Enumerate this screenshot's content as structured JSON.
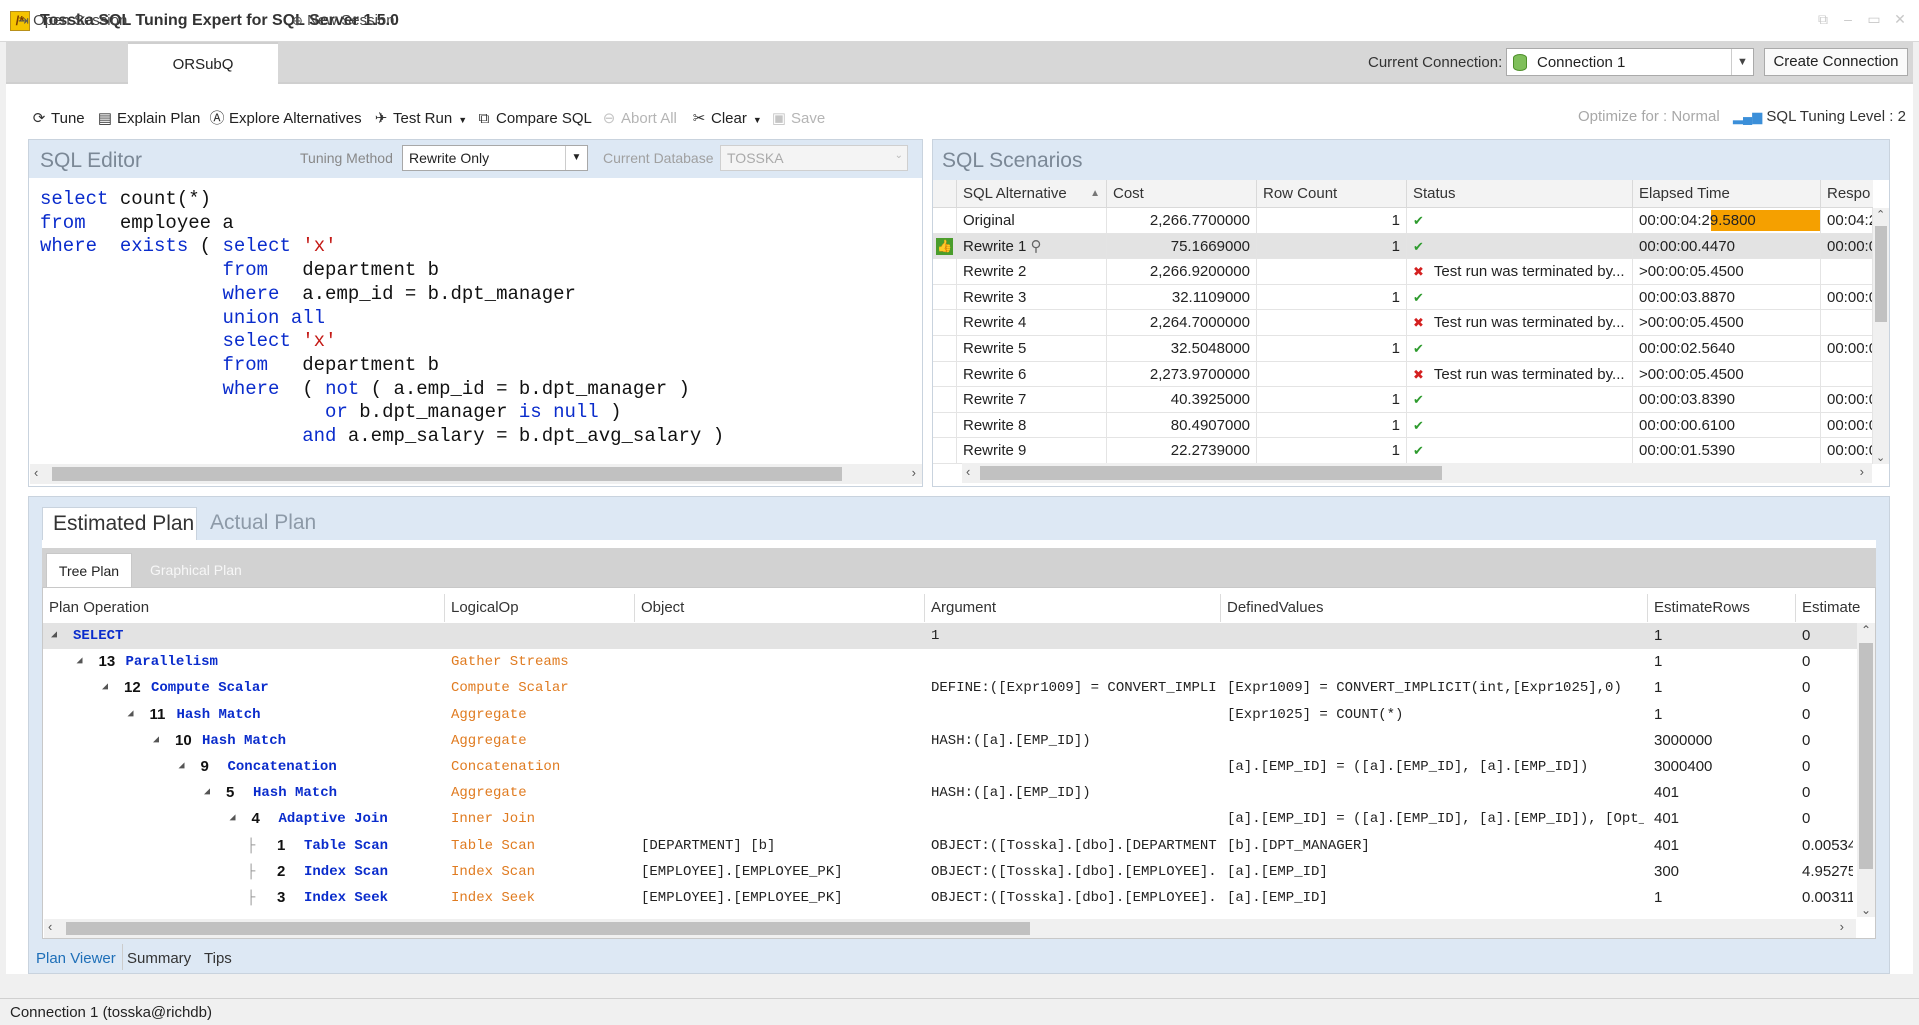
{
  "app": {
    "title": "Tosska SQL Tuning Expert for SQL Server 1.5.0",
    "icon_glyph": "/*"
  },
  "session_tabs": [
    {
      "label": "Open Session",
      "icon": "open-session-icon"
    },
    {
      "label": "ORSubQ",
      "active": true
    },
    {
      "label": "New Session",
      "icon": "new-session-icon"
    }
  ],
  "connection": {
    "label": "Current Connection:",
    "value": "Connection 1",
    "create_button": "Create Connection"
  },
  "toolbar": {
    "tune": "Tune",
    "explain_plan": "Explain Plan",
    "explore_alternatives": "Explore Alternatives",
    "test_run": "Test Run",
    "compare_sql": "Compare SQL",
    "abort_all": "Abort All",
    "clear": "Clear",
    "save": "Save",
    "optimize_for": "Optimize for : Normal",
    "tuning_level": "SQL Tuning Level : 2"
  },
  "editor": {
    "title": "SQL Editor",
    "tuning_method_label": "Tuning Method",
    "tuning_method_value": "Rewrite Only",
    "current_db_label": "Current Database",
    "current_db_value": "TOSSKA"
  },
  "scenarios": {
    "title": "SQL Scenarios",
    "columns": [
      "SQL Alternative",
      "Cost",
      "Row Count",
      "Status",
      "Elapsed Time",
      "Respo"
    ],
    "rows": [
      {
        "name": "Original",
        "cost": "2,266.7700000",
        "rows": "1",
        "status": "ok",
        "status_text": "",
        "elapsed": "00:00:04:29.5800",
        "resp": "00:04:2",
        "bar": 1.0
      },
      {
        "name": "Rewrite 1",
        "cost": "75.1669000",
        "rows": "1",
        "status": "ok",
        "status_text": "",
        "elapsed": "00:00:00.4470",
        "resp": "00:00:0",
        "best": true,
        "pin": true,
        "bar": 0
      },
      {
        "name": "Rewrite 2",
        "cost": "2,266.9200000",
        "rows": "",
        "status": "fail",
        "status_text": "Test run was terminated by...",
        "elapsed": ">00:00:05.4500",
        "resp": "",
        "bar": 0
      },
      {
        "name": "Rewrite 3",
        "cost": "32.1109000",
        "rows": "1",
        "status": "ok",
        "status_text": "",
        "elapsed": "00:00:03.8870",
        "resp": "00:00:0",
        "bar": 0
      },
      {
        "name": "Rewrite 4",
        "cost": "2,264.7000000",
        "rows": "",
        "status": "fail",
        "status_text": "Test run was terminated by...",
        "elapsed": ">00:00:05.4500",
        "resp": "",
        "bar": 0
      },
      {
        "name": "Rewrite 5",
        "cost": "32.5048000",
        "rows": "1",
        "status": "ok",
        "status_text": "",
        "elapsed": "00:00:02.5640",
        "resp": "00:00:0",
        "bar": 0
      },
      {
        "name": "Rewrite 6",
        "cost": "2,273.9700000",
        "rows": "",
        "status": "fail",
        "status_text": "Test run was terminated by...",
        "elapsed": ">00:00:05.4500",
        "resp": "",
        "bar": 0
      },
      {
        "name": "Rewrite 7",
        "cost": "40.3925000",
        "rows": "1",
        "status": "ok",
        "status_text": "",
        "elapsed": "00:00:03.8390",
        "resp": "00:00:0",
        "bar": 0
      },
      {
        "name": "Rewrite 8",
        "cost": "80.4907000",
        "rows": "1",
        "status": "ok",
        "status_text": "",
        "elapsed": "00:00:00.6100",
        "resp": "00:00:0",
        "bar": 0
      },
      {
        "name": "Rewrite 9",
        "cost": "22.2739000",
        "rows": "1",
        "status": "ok",
        "status_text": "",
        "elapsed": "00:00:01.5390",
        "resp": "00:00:0",
        "bar": 0
      }
    ]
  },
  "plan": {
    "tabs": [
      "Estimated Plan",
      "Actual Plan"
    ],
    "sub_tabs": [
      "Tree Plan",
      "Graphical Plan"
    ],
    "columns": [
      "Plan Operation",
      "LogicalOp",
      "Object",
      "Argument",
      "DefinedValues",
      "EstimateRows",
      "Estimate"
    ],
    "rows": [
      {
        "depth": 0,
        "id": "",
        "op": "SELECT",
        "logical": "",
        "object": "",
        "argument": "1",
        "defined": "",
        "erows": "1",
        "est": "0"
      },
      {
        "depth": 1,
        "id": "13",
        "op": "Parallelism",
        "logical": "Gather Streams",
        "object": "",
        "argument": "",
        "defined": "",
        "erows": "1",
        "est": "0"
      },
      {
        "depth": 2,
        "id": "12",
        "op": "Compute Scalar",
        "logical": "Compute Scalar",
        "object": "",
        "argument": "DEFINE:([Expr1009] = CONVERT_IMPLIC",
        "defined": "[Expr1009] = CONVERT_IMPLICIT(int,[Expr1025],0)",
        "erows": "1",
        "est": "0"
      },
      {
        "depth": 3,
        "id": "11",
        "op": "Hash Match",
        "logical": "Aggregate",
        "object": "",
        "argument": "",
        "defined": "[Expr1025] = COUNT(*)",
        "erows": "1",
        "est": "0"
      },
      {
        "depth": 4,
        "id": "10",
        "op": "Hash Match",
        "logical": "Aggregate",
        "object": "",
        "argument": "HASH:([a].[EMP_ID])",
        "defined": "",
        "erows": "3000000",
        "est": "0"
      },
      {
        "depth": 5,
        "id": "9",
        "op": "Concatenation",
        "logical": "Concatenation",
        "object": "",
        "argument": "",
        "defined": "[a].[EMP_ID] = ([a].[EMP_ID], [a].[EMP_ID])",
        "erows": "3000400",
        "est": "0"
      },
      {
        "depth": 6,
        "id": "5",
        "op": "Hash Match",
        "logical": "Aggregate",
        "object": "",
        "argument": "HASH:([a].[EMP_ID])",
        "defined": "",
        "erows": "401",
        "est": "0"
      },
      {
        "depth": 7,
        "id": "4",
        "op": "Adaptive Join",
        "logical": "Inner Join",
        "object": "",
        "argument": "",
        "defined": "[a].[EMP_ID] = ([a].[EMP_ID], [a].[EMP_ID]), [Opt_",
        "erows": "401",
        "est": "0"
      },
      {
        "depth": 8,
        "id": "1",
        "op": "Table Scan",
        "logical": "Table Scan",
        "object": "[DEPARTMENT] [b]",
        "argument": "OBJECT:([Tosska].[dbo].[DEPARTMENT",
        "defined": "[b].[DPT_MANAGER]",
        "erows": "401",
        "est": "0.00534"
      },
      {
        "depth": 8,
        "id": "2",
        "op": "Index Scan",
        "logical": "Index Scan",
        "object": "[EMPLOYEE].[EMPLOYEE_PK]",
        "argument": "OBJECT:([Tosska].[dbo].[EMPLOYEE].",
        "defined": "[a].[EMP_ID]",
        "erows": "300",
        "est": "4.95275"
      },
      {
        "depth": 8,
        "id": "3",
        "op": "Index Seek",
        "logical": "Index Seek",
        "object": "[EMPLOYEE].[EMPLOYEE_PK]",
        "argument": "OBJECT:([Tosska].[dbo].[EMPLOYEE].",
        "defined": "[a].[EMP_ID]",
        "erows": "1",
        "est": "0.00311"
      }
    ]
  },
  "bottom_tabs": [
    "Plan Viewer",
    "Summary",
    "Tips"
  ],
  "status_bar": "Connection 1 (tosska@richdb)",
  "colors": {
    "keyword": "#0a2ccc",
    "string": "#c41a16",
    "logical_op": "#e07b20",
    "accent": "#1e6fb8",
    "bar": "#f5a000"
  }
}
